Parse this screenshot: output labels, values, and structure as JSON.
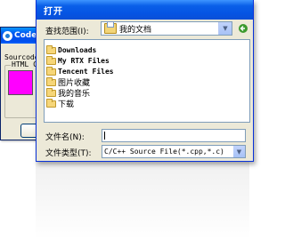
{
  "background_window": {
    "title": "Code",
    "source_label": "Sourcode:",
    "group_label": "HTML Co",
    "swatch_color": "#ff00ff"
  },
  "dialog": {
    "title": "打开",
    "look_in_label": "查找范围(I):",
    "look_in_value": "我的文档",
    "items": [
      {
        "label": "Downloads",
        "type": "folder",
        "latin": true
      },
      {
        "label": "My RTX Files",
        "type": "folder",
        "latin": true
      },
      {
        "label": "Tencent Files",
        "type": "folder",
        "latin": true
      },
      {
        "label": "图片收藏",
        "type": "folder",
        "latin": false
      },
      {
        "label": "我的音乐",
        "type": "folder",
        "latin": false
      },
      {
        "label": "下载",
        "type": "folder",
        "latin": false
      }
    ],
    "file_name_label": "文件名(N):",
    "file_name_value": "",
    "file_type_label": "文件类型(T):",
    "file_type_value": "C/C++ Source File(*.cpp,*.c)"
  }
}
